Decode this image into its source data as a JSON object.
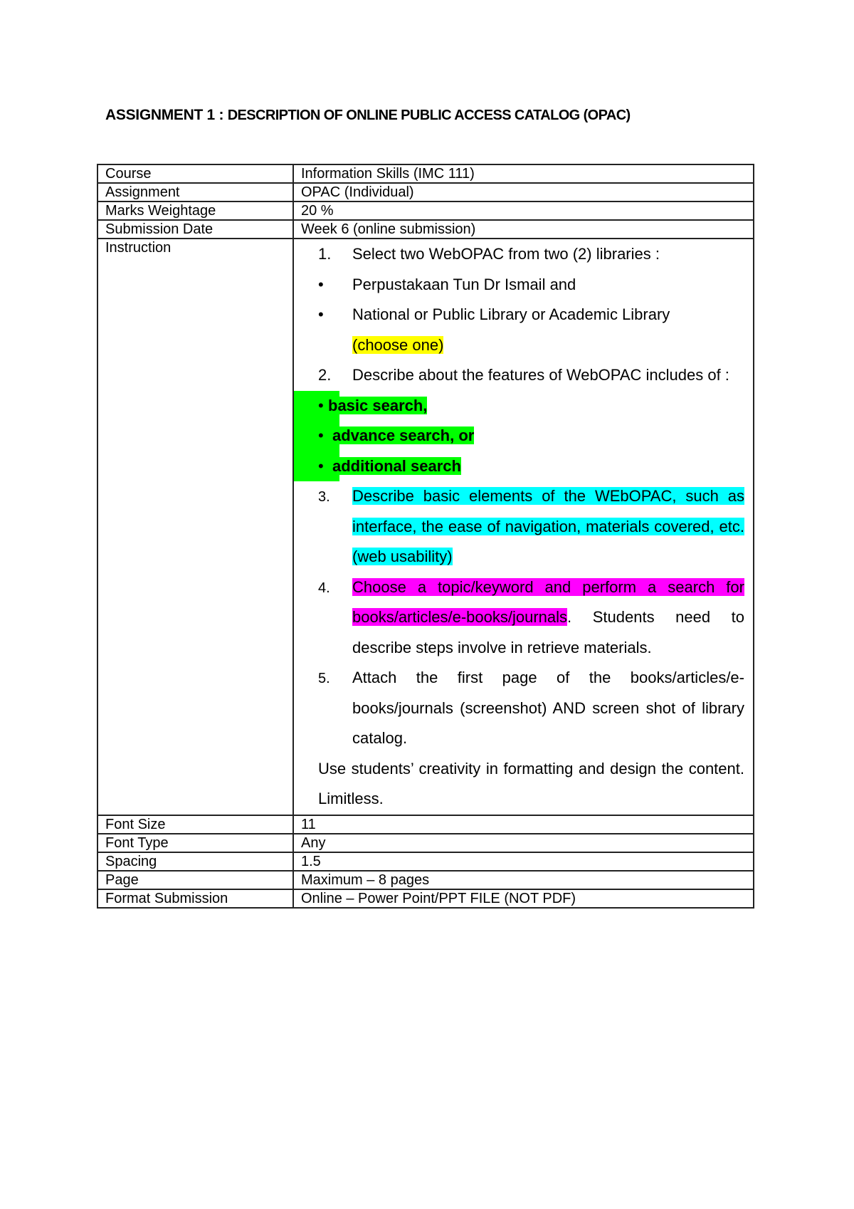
{
  "document": {
    "title_part1": "ASSIGNMENT 1 : ",
    "title_part2": "DESCRIPTION OF ONLINE PUBLIC ACCESS CATALOG (OPAC)"
  },
  "table": {
    "rows_top": [
      {
        "label": "Course",
        "value": "Information Skills (IMC 111)"
      },
      {
        "label": "Assignment",
        "value": "OPAC (Individual)"
      },
      {
        "label": "Marks Weightage",
        "value": "20 %"
      },
      {
        "label": "Submission Date",
        "value": "Week 6 (online submission)"
      }
    ],
    "instruction": {
      "label": "Instruction",
      "item1": {
        "num": "1.",
        "text": "Select two WebOPAC from two (2) libraries :"
      },
      "bullet1": {
        "marker": "•",
        "text": "Perpustakaan Tun Dr Ismail and"
      },
      "bullet2": {
        "marker": "•",
        "text": "National or Public Library or Academic Library",
        "highlight": "(choose one)"
      },
      "item2": {
        "num": "2.",
        "text": "Describe about the features of WebOPAC includes of :"
      },
      "search_bullets": [
        {
          "marker": "•",
          "text": "basic search,"
        },
        {
          "marker": "•",
          "text": "advance search, or"
        },
        {
          "marker": "•",
          "text": "additional search"
        }
      ],
      "item3": {
        "num": "3.",
        "text": "Describe basic elements of the WEbOPAC, such as interface, the ease of navigation, materials covered, etc.",
        "text2": "(web usability)"
      },
      "item4": {
        "num": "4.",
        "highlight": "Choose a topic/keyword and perform a search for books/articles/e-books/journals",
        "text": ". Students need to describe steps involve in retrieve materials."
      },
      "item5": {
        "num": "5.",
        "text": "Attach the first page of the books/articles/e-books/journals (screenshot) AND screen shot of library catalog."
      },
      "note": "Use students’ creativity in formatting and design the content. Limitless."
    },
    "rows_bottom": [
      {
        "label": "Font Size",
        "value": "11"
      },
      {
        "label": "Font Type",
        "value": "Any"
      },
      {
        "label": "Spacing",
        "value": "1.5"
      },
      {
        "label": "Page",
        "value": "Maximum – 8 pages"
      },
      {
        "label": "Format Submission",
        "value": "Online – Power Point/PPT FILE (NOT PDF)"
      }
    ]
  },
  "colors": {
    "highlight_yellow": "#ffff00",
    "highlight_green": "#00ff00",
    "highlight_cyan": "#00ffff",
    "highlight_magenta": "#ff00ff"
  }
}
